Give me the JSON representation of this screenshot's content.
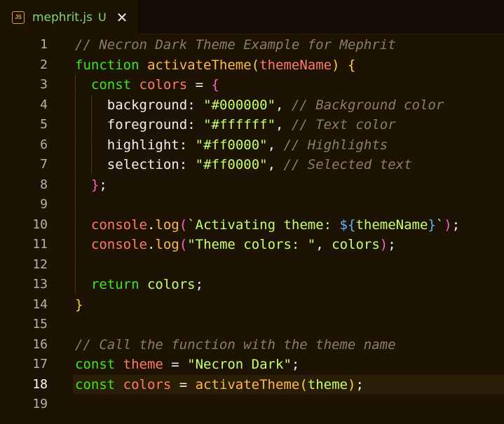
{
  "tab": {
    "icon_label": "JS",
    "icon": "js-file-icon",
    "filename": "mephrit.js",
    "status": "U",
    "close": "✕"
  },
  "editor": {
    "current_line": 18,
    "lines": [
      {
        "num": "1",
        "indent": 0,
        "tokens": [
          {
            "t": "// Necron Dark Theme Example for Mephrit",
            "c": "comment"
          }
        ]
      },
      {
        "num": "2",
        "indent": 0,
        "tokens": [
          {
            "t": "function ",
            "c": "keyword"
          },
          {
            "t": "activateTheme",
            "c": "func"
          },
          {
            "t": "(",
            "c": "brace1"
          },
          {
            "t": "themeName",
            "c": "ident"
          },
          {
            "t": ") ",
            "c": "brace1"
          },
          {
            "t": "{",
            "c": "brace1"
          }
        ]
      },
      {
        "num": "3",
        "indent": 1,
        "tokens": [
          {
            "t": "const ",
            "c": "keyword"
          },
          {
            "t": "colors",
            "c": "ident"
          },
          {
            "t": " = ",
            "c": "op"
          },
          {
            "t": "{",
            "c": "brace2"
          }
        ]
      },
      {
        "num": "4",
        "indent": 2,
        "tokens": [
          {
            "t": "background",
            "c": "prop"
          },
          {
            "t": ": ",
            "c": "punct"
          },
          {
            "t": "\"#000000\"",
            "c": "string"
          },
          {
            "t": ", ",
            "c": "punct"
          },
          {
            "t": "// Background color",
            "c": "comment"
          }
        ]
      },
      {
        "num": "5",
        "indent": 2,
        "tokens": [
          {
            "t": "foreground",
            "c": "prop"
          },
          {
            "t": ": ",
            "c": "punct"
          },
          {
            "t": "\"#ffffff\"",
            "c": "string"
          },
          {
            "t": ", ",
            "c": "punct"
          },
          {
            "t": "// Text color",
            "c": "comment"
          }
        ]
      },
      {
        "num": "6",
        "indent": 2,
        "tokens": [
          {
            "t": "highlight",
            "c": "prop"
          },
          {
            "t": ": ",
            "c": "punct"
          },
          {
            "t": "\"#ff0000\"",
            "c": "string"
          },
          {
            "t": ", ",
            "c": "punct"
          },
          {
            "t": "// Highlights",
            "c": "comment"
          }
        ]
      },
      {
        "num": "7",
        "indent": 2,
        "tokens": [
          {
            "t": "selection",
            "c": "prop"
          },
          {
            "t": ": ",
            "c": "punct"
          },
          {
            "t": "\"#ff0000\"",
            "c": "string"
          },
          {
            "t": ", ",
            "c": "punct"
          },
          {
            "t": "// Selected text",
            "c": "comment"
          }
        ]
      },
      {
        "num": "8",
        "indent": 1,
        "tokens": [
          {
            "t": "}",
            "c": "brace2"
          },
          {
            "t": ";",
            "c": "punct"
          }
        ]
      },
      {
        "num": "9",
        "indent": 1,
        "tokens": []
      },
      {
        "num": "10",
        "indent": 1,
        "tokens": [
          {
            "t": "console",
            "c": "ident"
          },
          {
            "t": ".",
            "c": "punct"
          },
          {
            "t": "log",
            "c": "func"
          },
          {
            "t": "(",
            "c": "brace2"
          },
          {
            "t": "`Activating theme: ",
            "c": "template"
          },
          {
            "t": "${",
            "c": "brace3"
          },
          {
            "t": "themeName",
            "c": "var"
          },
          {
            "t": "}",
            "c": "brace3"
          },
          {
            "t": "`",
            "c": "template"
          },
          {
            "t": ")",
            "c": "brace2"
          },
          {
            "t": ";",
            "c": "punct"
          }
        ]
      },
      {
        "num": "11",
        "indent": 1,
        "tokens": [
          {
            "t": "console",
            "c": "ident"
          },
          {
            "t": ".",
            "c": "punct"
          },
          {
            "t": "log",
            "c": "func"
          },
          {
            "t": "(",
            "c": "brace2"
          },
          {
            "t": "\"Theme colors: \"",
            "c": "string"
          },
          {
            "t": ", ",
            "c": "punct"
          },
          {
            "t": "colors",
            "c": "var"
          },
          {
            "t": ")",
            "c": "brace2"
          },
          {
            "t": ";",
            "c": "punct"
          }
        ]
      },
      {
        "num": "12",
        "indent": 1,
        "tokens": []
      },
      {
        "num": "13",
        "indent": 1,
        "tokens": [
          {
            "t": "return ",
            "c": "keyword"
          },
          {
            "t": "colors",
            "c": "var"
          },
          {
            "t": ";",
            "c": "punct"
          }
        ]
      },
      {
        "num": "14",
        "indent": 0,
        "tokens": [
          {
            "t": "}",
            "c": "brace1"
          }
        ]
      },
      {
        "num": "15",
        "indent": 0,
        "tokens": []
      },
      {
        "num": "16",
        "indent": 0,
        "tokens": [
          {
            "t": "// Call the function with the theme name",
            "c": "comment"
          }
        ]
      },
      {
        "num": "17",
        "indent": 0,
        "tokens": [
          {
            "t": "const ",
            "c": "keyword"
          },
          {
            "t": "theme",
            "c": "ident"
          },
          {
            "t": " = ",
            "c": "op"
          },
          {
            "t": "\"Necron Dark\"",
            "c": "string"
          },
          {
            "t": ";",
            "c": "punct"
          }
        ]
      },
      {
        "num": "18",
        "indent": 0,
        "tokens": [
          {
            "t": "const ",
            "c": "keyword"
          },
          {
            "t": "colors",
            "c": "ident"
          },
          {
            "t": " = ",
            "c": "op"
          },
          {
            "t": "activateTheme",
            "c": "func"
          },
          {
            "t": "(",
            "c": "brace1"
          },
          {
            "t": "theme",
            "c": "var"
          },
          {
            "t": ")",
            "c": "brace1"
          },
          {
            "t": ";",
            "c": "punct"
          }
        ]
      },
      {
        "num": "19",
        "indent": 0,
        "tokens": []
      }
    ]
  }
}
